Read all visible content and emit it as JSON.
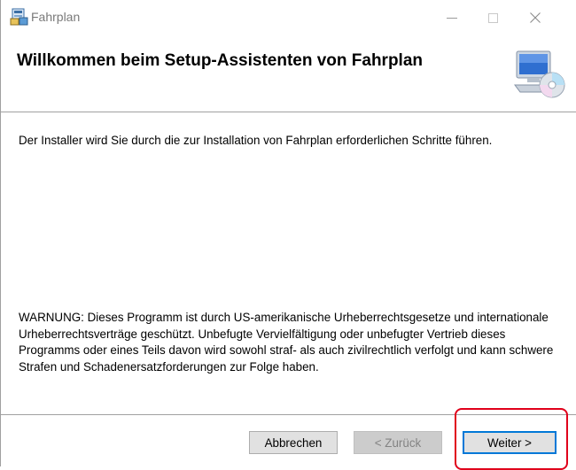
{
  "window": {
    "title": "Fahrplan",
    "controls": {
      "minimize": "—",
      "maximize": "☐",
      "close": "✕"
    }
  },
  "banner": {
    "heading": "Willkommen beim Setup-Assistenten von Fahrplan",
    "icon": "computer-cd-icon"
  },
  "body": {
    "intro": "Der Installer wird Sie durch die zur Installation von Fahrplan erforderlichen Schritte führen.",
    "warning": "WARNUNG: Dieses Programm ist durch US-amerikanische Urheberrechtsgesetze und internationale Urheberrechtsverträge geschützt. Unbefugte Vervielfältigung oder unbefugter Vertrieb dieses Programms oder eines Teils davon wird sowohl straf- als auch zivilrechtlich verfolgt und kann schwere Strafen und Schadenersatzforderungen zur Folge haben."
  },
  "buttons": {
    "cancel": "Abbrechen",
    "back": "< Zurück",
    "next": "Weiter >"
  },
  "colors": {
    "highlight": "#e0001b",
    "focus_border": "#0078d7"
  }
}
